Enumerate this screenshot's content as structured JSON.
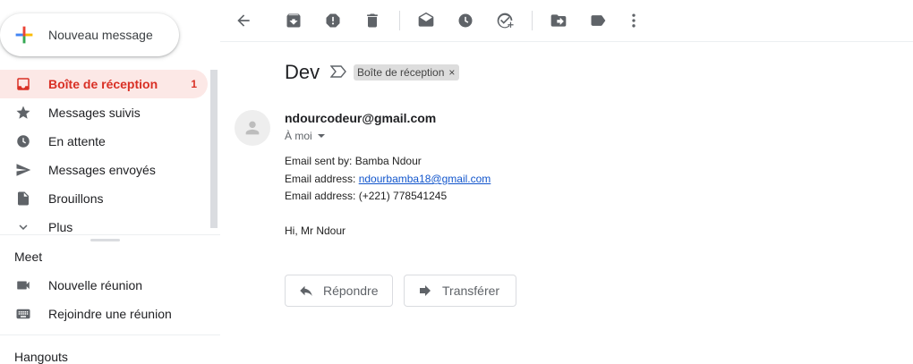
{
  "compose": {
    "label": "Nouveau message"
  },
  "nav": {
    "items": [
      {
        "label": "Boîte de réception",
        "count": "1",
        "icon": "inbox-icon",
        "active": true
      },
      {
        "label": "Messages suivis",
        "icon": "star-icon"
      },
      {
        "label": "En attente",
        "icon": "clock-icon"
      },
      {
        "label": "Messages envoyés",
        "icon": "send-icon"
      },
      {
        "label": "Brouillons",
        "icon": "draft-icon"
      },
      {
        "label": "Plus",
        "icon": "chevron-down-icon"
      }
    ]
  },
  "meet": {
    "title": "Meet",
    "items": [
      {
        "label": "Nouvelle réunion",
        "icon": "videocam-icon"
      },
      {
        "label": "Rejoindre une réunion",
        "icon": "keyboard-icon"
      }
    ]
  },
  "hangouts": {
    "title": "Hangouts"
  },
  "toolbar": {
    "buttons": [
      "back-icon",
      "archive-icon",
      "report-spam-icon",
      "delete-icon",
      "mark-unread-icon",
      "snooze-icon",
      "add-to-tasks-icon",
      "move-to-icon",
      "label-icon",
      "more-icon"
    ]
  },
  "message": {
    "subject": "Dev",
    "label_chip": "Boîte de réception",
    "label_chip_close": "×",
    "sender": "ndourcodeur@gmail.com",
    "to": "À moi",
    "lines": {
      "l1": "Email sent by: Bamba Ndour",
      "l2_prefix": "Email address: ",
      "l2_link": "ndourbamba18@gmail.com",
      "l3": "Email address: (+221) 778541245",
      "l4": "Hi, Mr Ndour"
    }
  },
  "actions": {
    "reply": "Répondre",
    "forward": "Transférer"
  },
  "colors": {
    "active_red": "#d93025",
    "active_bg": "#fce8e6",
    "link": "#1155cc",
    "icon_gray": "#5f6368"
  }
}
